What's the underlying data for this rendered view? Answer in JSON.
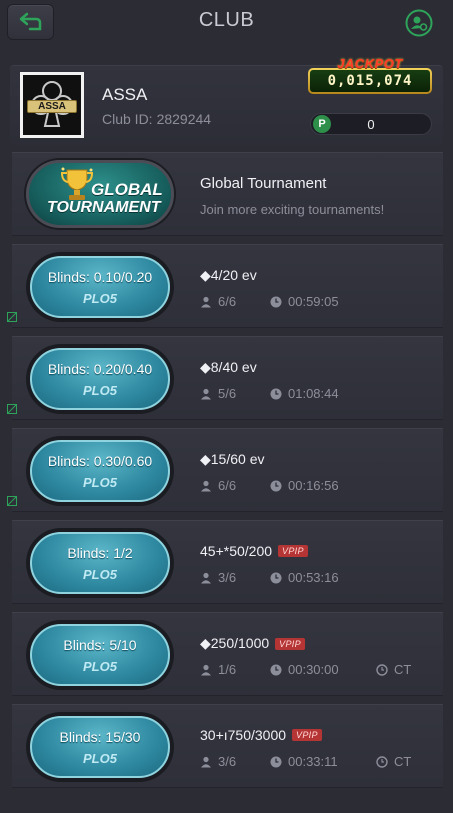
{
  "header": {
    "title": "CLUB",
    "back_icon": "back-arrow-icon",
    "user_icon": "user-settings-icon",
    "accent": "#2ea35a"
  },
  "club": {
    "name": "ASSA",
    "logo_text": "ASSA",
    "id_label": "Club ID:",
    "id_value": "2829244",
    "jackpot_label": "JACKPOT",
    "jackpot_value": "0,015,074",
    "points_badge": "P",
    "points_value": "0"
  },
  "global_tournament": {
    "badge_line1": "GLOBAL",
    "badge_line2": "TOURNAMENT",
    "title": "Global Tournament",
    "subtitle": "Join more exciting tournaments!"
  },
  "tables": [
    {
      "blinds": "Blinds: 0.10/0.20",
      "game": "PLO5",
      "stake": "◆4/20 ev",
      "vpip": "",
      "players": "6/6",
      "time": "00:59:05",
      "ct": "",
      "side_icon": true
    },
    {
      "blinds": "Blinds: 0.20/0.40",
      "game": "PLO5",
      "stake": "◆8/40 ev",
      "vpip": "",
      "players": "5/6",
      "time": "01:08:44",
      "ct": "",
      "side_icon": true
    },
    {
      "blinds": "Blinds: 0.30/0.60",
      "game": "PLO5",
      "stake": "◆15/60 ev",
      "vpip": "",
      "players": "6/6",
      "time": "00:16:56",
      "ct": "",
      "side_icon": true
    },
    {
      "blinds": "Blinds: 1/2",
      "game": "PLO5",
      "stake": "45+*50/200",
      "vpip": "VPIP",
      "players": "3/6",
      "time": "00:53:16",
      "ct": "",
      "side_icon": false
    },
    {
      "blinds": "Blinds: 5/10",
      "game": "PLO5",
      "stake": "◆250/1000",
      "vpip": "VPIP",
      "players": "1/6",
      "time": "00:30:00",
      "ct": "CT",
      "side_icon": false
    },
    {
      "blinds": "Blinds: 15/30",
      "game": "PLO5",
      "stake": "30+ı750/3000",
      "vpip": "VPIP",
      "players": "3/6",
      "time": "00:33:11",
      "ct": "CT",
      "side_icon": false
    }
  ]
}
